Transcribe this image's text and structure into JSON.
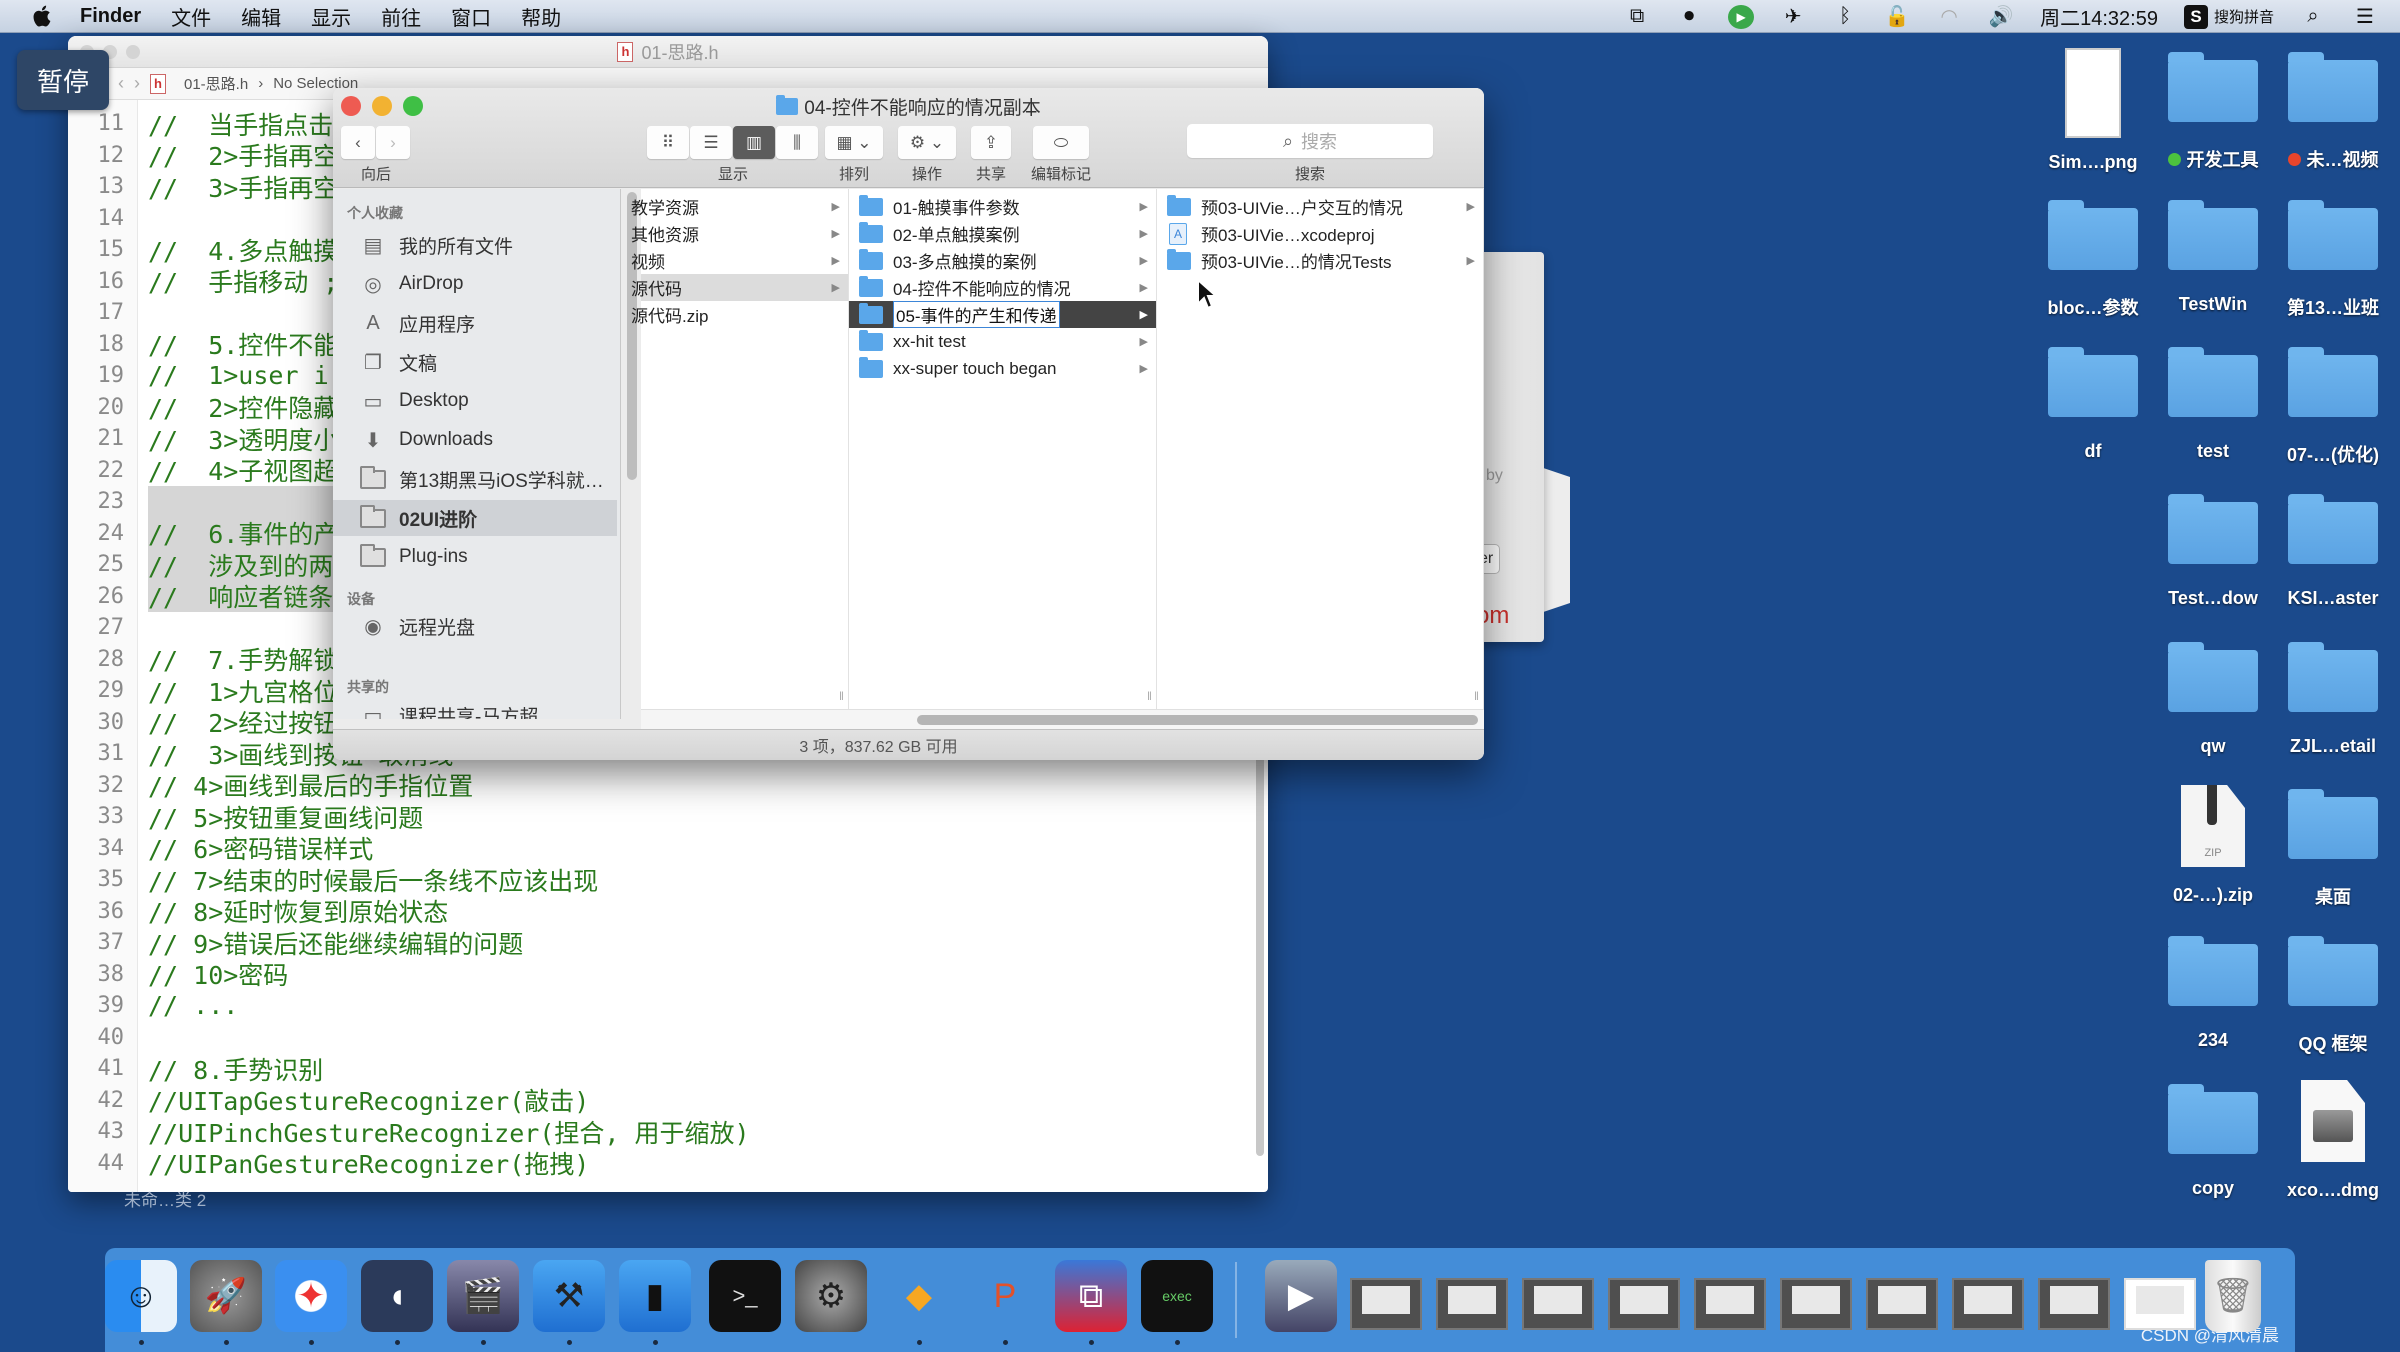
{
  "menubar": {
    "app_name": "Finder",
    "items": [
      "文件",
      "编辑",
      "显示",
      "前往",
      "窗口",
      "帮助"
    ],
    "clock": "周二14:32:59",
    "input_method": "搜狗拼音",
    "input_method_glyph": "S"
  },
  "overlay": {
    "pause_label": "暂停"
  },
  "editor": {
    "window_title": "01-思路.h",
    "jumpbar": {
      "file": "01-思路.h",
      "selection": "No Selection"
    },
    "lines": [
      {
        "n": "11",
        "text": "//  当手指点击"
      },
      {
        "n": "12",
        "text": "//  2>手指再空"
      },
      {
        "n": "13",
        "text": "//  3>手指再空"
      },
      {
        "n": "14",
        "text": ""
      },
      {
        "n": "15",
        "text": "//  4.多点触摸"
      },
      {
        "n": "16",
        "text": "//  手指移动 ;"
      },
      {
        "n": "17",
        "text": ""
      },
      {
        "n": "18",
        "text": "//  5.控件不能"
      },
      {
        "n": "19",
        "text": "//  1>user i"
      },
      {
        "n": "20",
        "text": "//  2>控件隐藏"
      },
      {
        "n": "21",
        "text": "//  3>透明度小"
      },
      {
        "n": "22",
        "text": "//  4>子视图超"
      },
      {
        "n": "23",
        "text": ""
      },
      {
        "n": "24",
        "text": "//  6.事件的产"
      },
      {
        "n": "25",
        "text": "//  涉及到的两"
      },
      {
        "n": "26",
        "text": "//  响应者链条"
      },
      {
        "n": "27",
        "text": ""
      },
      {
        "n": "28",
        "text": "//  7.手势解锁"
      },
      {
        "n": "29",
        "text": "//  1>九宫格位"
      },
      {
        "n": "30",
        "text": "//  2>经过按钮"
      },
      {
        "n": "31",
        "text": "//  3>画线到按钮 取消线"
      },
      {
        "n": "32",
        "text": "// 4>画线到最后的手指位置"
      },
      {
        "n": "33",
        "text": "// 5>按钮重复画线问题"
      },
      {
        "n": "34",
        "text": "// 6>密码错误样式"
      },
      {
        "n": "35",
        "text": "// 7>结束的时候最后一条线不应该出现"
      },
      {
        "n": "36",
        "text": "// 8>延时恢复到原始状态"
      },
      {
        "n": "37",
        "text": "// 9>错误后还能继续编辑的问题"
      },
      {
        "n": "38",
        "text": "// 10>密码"
      },
      {
        "n": "39",
        "text": "// ..."
      },
      {
        "n": "40",
        "text": ""
      },
      {
        "n": "41",
        "text": "// 8.手势识别"
      },
      {
        "n": "42",
        "text": "//UITapGestureRecognizer(敲击)"
      },
      {
        "n": "43",
        "text": "//UIPinchGestureRecognizer(捏合, 用于缩放)"
      },
      {
        "n": "44",
        "text": "//UIPanGestureRecognizer(拖拽)"
      }
    ]
  },
  "background_dialog": {
    "text_by": "by",
    "button_fragment": "er",
    "link_fragment": "om"
  },
  "finder": {
    "title": "04-控件不能响应的情况副本",
    "toolbar": {
      "back_label": "向后",
      "view_label": "显示",
      "arrange_label": "排列",
      "action_label": "操作",
      "share_label": "共享",
      "tags_label": "编辑标记",
      "search_placeholder": "搜索",
      "search_label": "搜索",
      "active_view": "column"
    },
    "sidebar": {
      "favorites_header": "个人收藏",
      "favorites": [
        {
          "label": "我的所有文件",
          "icon": "all-files-icon"
        },
        {
          "label": "AirDrop",
          "icon": "airdrop-icon"
        },
        {
          "label": "应用程序",
          "icon": "applications-icon"
        },
        {
          "label": "文稿",
          "icon": "documents-icon"
        },
        {
          "label": "Desktop",
          "icon": "desktop-icon"
        },
        {
          "label": "Downloads",
          "icon": "downloads-icon"
        },
        {
          "label": "第13期黑马iOS学科就…",
          "icon": "folder-icon"
        },
        {
          "label": "02UI进阶",
          "icon": "folder-icon",
          "selected": true
        },
        {
          "label": "Plug-ins",
          "icon": "folder-icon"
        }
      ],
      "devices_header": "设备",
      "devices": [
        {
          "label": "远程光盘",
          "icon": "remote-disc-icon"
        }
      ],
      "shared_header": "共享的",
      "shared": [
        {
          "label": "课程共享-马方超",
          "icon": "shared-computer-icon"
        }
      ]
    },
    "columns": [
      {
        "items": [
          {
            "label": "教学资源",
            "arrow": true
          },
          {
            "label": "其他资源",
            "arrow": true
          },
          {
            "label": "视频",
            "arrow": true
          },
          {
            "label": "源代码",
            "arrow": true,
            "selected": "inactive"
          },
          {
            "label": "源代码.zip",
            "arrow": false
          }
        ]
      },
      {
        "items": [
          {
            "label": "01-触摸事件参数",
            "arrow": true
          },
          {
            "label": "02-单点触摸案例",
            "arrow": true
          },
          {
            "label": "03-多点触摸的案例",
            "arrow": true
          },
          {
            "label": "04-控件不能响应的情况",
            "arrow": true
          },
          {
            "label": "05-事件的产生和传递",
            "arrow": true,
            "selected": "renaming"
          },
          {
            "label": "xx-hit test",
            "arrow": true
          },
          {
            "label": "xx-super touch began",
            "arrow": true
          }
        ]
      },
      {
        "items": [
          {
            "label": "预03-UIVie…户交互的情况",
            "arrow": true,
            "type": "folder"
          },
          {
            "label": "预03-UIVie…xcodeproj",
            "arrow": false,
            "type": "xcodeproj"
          },
          {
            "label": "预03-UIVie…的情况Tests",
            "arrow": true,
            "type": "folder"
          }
        ]
      }
    ],
    "status": "3 项，837.62 GB 可用"
  },
  "desktop": {
    "icons": [
      {
        "label": "Sim….png",
        "type": "image"
      },
      {
        "label": "开发工具",
        "type": "folder",
        "tag": "#4cc23e"
      },
      {
        "label": "未…视频",
        "type": "folder",
        "tag": "#e8452c"
      },
      {
        "label": "bloc…参数",
        "type": "folder"
      },
      {
        "label": "TestWin",
        "type": "folder"
      },
      {
        "label": "第13…业班",
        "type": "folder"
      },
      {
        "label": "df",
        "type": "folder"
      },
      {
        "label": "test",
        "type": "folder"
      },
      {
        "label": "07-…(优化)",
        "type": "folder"
      },
      {
        "label": "Test…dow",
        "type": "folder"
      },
      {
        "label": "KSI…aster",
        "type": "folder"
      },
      {
        "label": "qw",
        "type": "folder"
      },
      {
        "label": "ZJL…etail",
        "type": "folder"
      },
      {
        "label": "02-…).zip",
        "type": "zip"
      },
      {
        "label": "桌面",
        "type": "folder"
      },
      {
        "label": "234",
        "type": "folder"
      },
      {
        "label": "QQ 框架",
        "type": "folder"
      },
      {
        "label": "copy",
        "type": "folder"
      },
      {
        "label": "xco….dmg",
        "type": "dmg"
      }
    ],
    "bottom_left_label": "未命…类 2"
  },
  "dock": {
    "apps": [
      {
        "name": "Finder",
        "icon": "finder-icon",
        "running": true
      },
      {
        "name": "Launchpad",
        "icon": "launchpad-icon",
        "running": true
      },
      {
        "name": "Safari",
        "icon": "safari-icon",
        "running": true
      },
      {
        "name": "Mouse Locator",
        "icon": "mouse-icon",
        "running": true
      },
      {
        "name": "Video Player",
        "icon": "movie-player-icon",
        "running": true
      },
      {
        "name": "Xcode",
        "icon": "xcode-icon",
        "running": true
      },
      {
        "name": "Simulator",
        "icon": "simulator-icon",
        "running": true
      },
      {
        "name": "Terminal",
        "icon": "terminal-icon",
        "running": false
      },
      {
        "name": "System Preferences",
        "icon": "system-preferences-icon",
        "running": false
      },
      {
        "name": "Sketch",
        "icon": "sketch-icon",
        "running": true
      },
      {
        "name": "PowerPoint-like",
        "icon": "p-app-icon",
        "running": true
      },
      {
        "name": "Virtual Machine",
        "icon": "vm-icon",
        "running": true
      },
      {
        "name": "Console",
        "icon": "console-icon",
        "running": true
      }
    ],
    "minimized_windows_count": 10,
    "watermark": "CSDN @清风清晨"
  }
}
